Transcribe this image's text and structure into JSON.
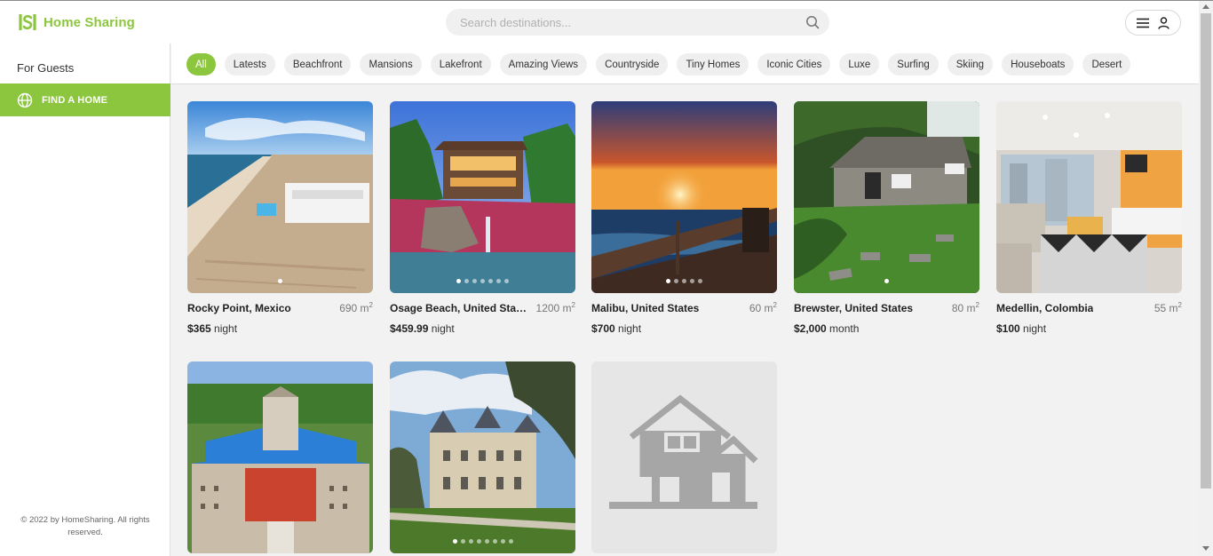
{
  "app": {
    "name": "Home Sharing",
    "brand_color": "#8cc63e"
  },
  "search": {
    "placeholder": "Search destinations...",
    "value": ""
  },
  "header": {
    "menu_icon": "hamburger-icon",
    "user_icon": "user-icon"
  },
  "sidebar": {
    "heading": "For Guests",
    "items": [
      {
        "label": "FIND A HOME",
        "icon": "globe-icon",
        "active": true
      }
    ],
    "footer": "© 2022 by HomeSharing. All rights reserved."
  },
  "filters": [
    {
      "label": "All",
      "active": true
    },
    {
      "label": "Latests"
    },
    {
      "label": "Beachfront"
    },
    {
      "label": "Mansions"
    },
    {
      "label": "Lakefront"
    },
    {
      "label": "Amazing Views"
    },
    {
      "label": "Countryside"
    },
    {
      "label": "Tiny Homes"
    },
    {
      "label": "Iconic Cities"
    },
    {
      "label": "Luxe"
    },
    {
      "label": "Surfing"
    },
    {
      "label": "Skiing"
    },
    {
      "label": "Houseboats"
    },
    {
      "label": "Desert"
    }
  ],
  "listings": [
    {
      "location": "Rocky Point, Mexico",
      "area": "690 m",
      "area_unit_sup": "2",
      "price": "$365",
      "period": "night"
    },
    {
      "location": "Osage Beach, United States",
      "area": "1200 m",
      "area_unit_sup": "2",
      "price": "$459.99",
      "period": "night"
    },
    {
      "location": "Malibu, United States",
      "area": "60 m",
      "area_unit_sup": "2",
      "price": "$700",
      "period": "night"
    },
    {
      "location": "Brewster, United States",
      "area": "80 m",
      "area_unit_sup": "2",
      "price": "$2,000",
      "period": "month"
    },
    {
      "location": "Medellin, Colombia",
      "area": "55 m",
      "area_unit_sup": "2",
      "price": "$100",
      "period": "night"
    },
    {
      "location": "",
      "area": "",
      "area_unit_sup": "",
      "price": "",
      "period": ""
    },
    {
      "location": "",
      "area": "",
      "area_unit_sup": "",
      "price": "",
      "period": ""
    },
    {
      "location": "",
      "area": "",
      "area_unit_sup": "",
      "price": "",
      "period": ""
    }
  ]
}
